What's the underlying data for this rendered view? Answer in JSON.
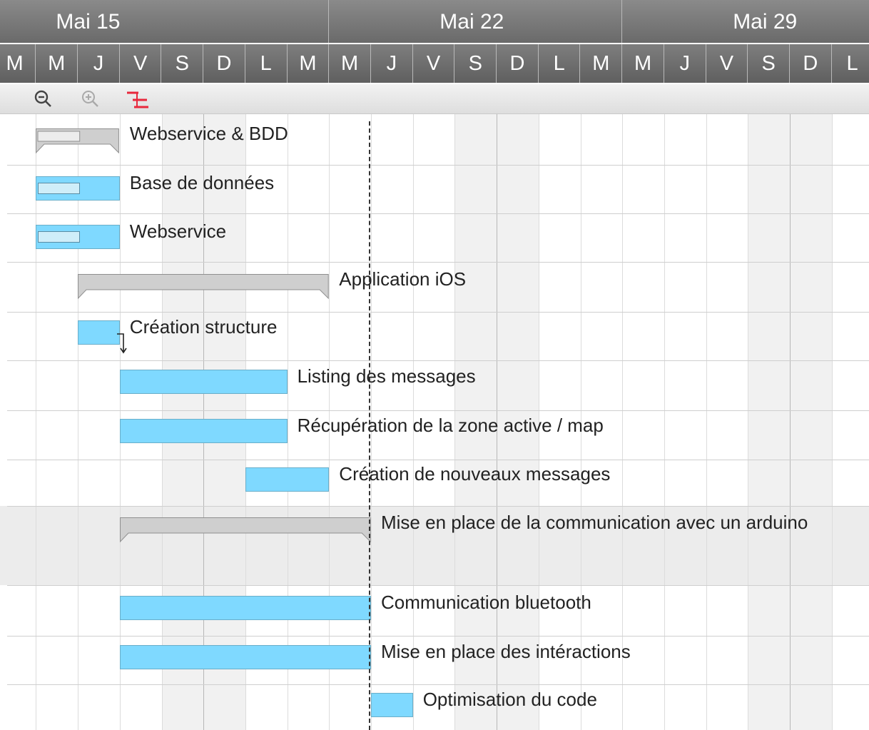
{
  "timeline": {
    "weeks": [
      "Mai 15",
      "Mai 22",
      "Mai 29",
      ""
    ],
    "days": [
      "M",
      "M",
      "J",
      "V",
      "S",
      "D",
      "L",
      "M",
      "M",
      "J",
      "V",
      "S",
      "D",
      "L",
      "M",
      "M",
      "J",
      "V",
      "S",
      "D",
      "L"
    ]
  },
  "toolbar": {
    "zoom_out_icon": "zoom-out-icon",
    "zoom_in_icon": "zoom-in-icon",
    "critical_path_icon": "critical-path-icon",
    "colors": {
      "critical": "#e8283c"
    }
  },
  "colors": {
    "task_bar": "#7fd9ff",
    "summary_bar": "#cfcfcf",
    "today_line": "#333333"
  },
  "tasks": [
    {
      "name": "Webservice & BDD",
      "kind": "summary",
      "start": "2017-05-15",
      "end": "2017-05-16"
    },
    {
      "name": "Base de données",
      "kind": "task",
      "start": "2017-05-15",
      "end": "2017-05-16",
      "progress": 0.5
    },
    {
      "name": "Webservice",
      "kind": "task",
      "start": "2017-05-15",
      "end": "2017-05-16",
      "progress": 0.5
    },
    {
      "name": "Application iOS",
      "kind": "summary",
      "start": "2017-05-16",
      "end": "2017-05-21"
    },
    {
      "name": "Création structure",
      "kind": "task",
      "start": "2017-05-16",
      "end": "2017-05-16"
    },
    {
      "name": "Listing des messages",
      "kind": "task",
      "start": "2017-05-17",
      "end": "2017-05-20"
    },
    {
      "name": "Récupération de la zone active / map",
      "kind": "task",
      "start": "2017-05-17",
      "end": "2017-05-20"
    },
    {
      "name": "Création de nouveaux messages",
      "kind": "task",
      "start": "2017-05-20",
      "end": "2017-05-21"
    },
    {
      "name": "Mise en place de la communication avec un arduino",
      "kind": "summary",
      "start": "2017-05-17",
      "end": "2017-05-22"
    },
    {
      "name": "Communication bluetooth",
      "kind": "task",
      "start": "2017-05-17",
      "end": "2017-05-22"
    },
    {
      "name": "Mise en place des intéractions",
      "kind": "task",
      "start": "2017-05-17",
      "end": "2017-05-22"
    },
    {
      "name": "Optimisation du code",
      "kind": "task",
      "start": "2017-05-23",
      "end": "2017-05-23"
    }
  ]
}
